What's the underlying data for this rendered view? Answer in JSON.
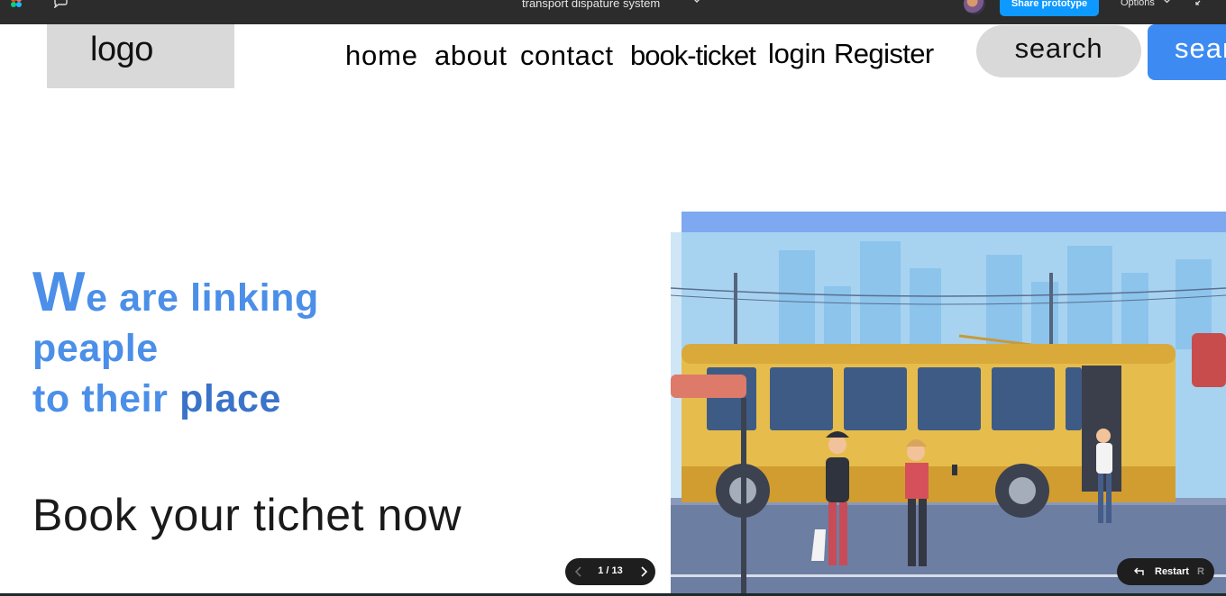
{
  "toolbar": {
    "file_title": "transport dispature system",
    "share_label": "Share prototype",
    "options_label": "Options"
  },
  "nav": {
    "logo": "logo",
    "links": [
      "home",
      "about",
      "contact",
      "book-ticket",
      "login",
      "Register"
    ],
    "search_label": "search",
    "search_button_label": "sear"
  },
  "hero": {
    "title_first_letter": "W",
    "title_line1_rest": "e are linking",
    "title_line2": "peaple",
    "title_line3_a": "to their ",
    "title_line3_b": "place",
    "subtitle": "Book your tichet now"
  },
  "prototype_controls": {
    "page_indicator": "1 / 13",
    "restart_label": "Restart",
    "restart_shortcut": "R"
  },
  "colors": {
    "accent_blue": "#4b8fe8",
    "button_blue": "#3d8bf2",
    "figma_blue": "#0d99ff",
    "toolbar_bg": "#2c2c2c"
  }
}
